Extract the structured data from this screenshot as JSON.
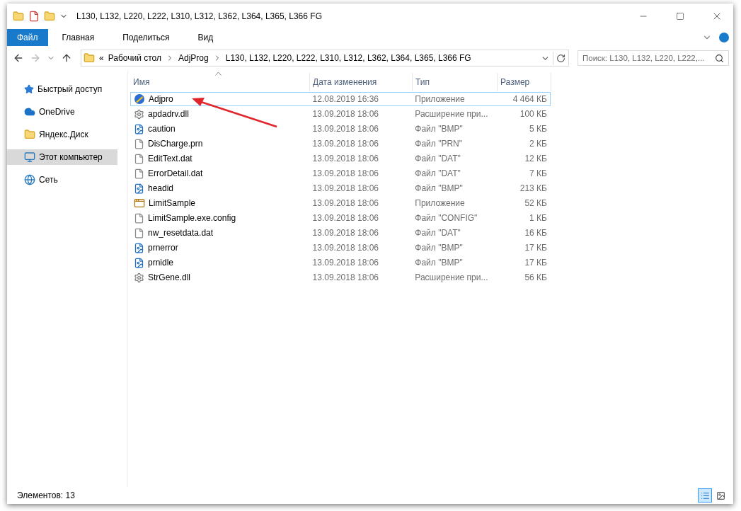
{
  "window": {
    "title": "L130, L132, L220, L222, L310, L312, L362, L364, L365, L366 FG"
  },
  "ribbon": {
    "tabs": [
      {
        "label": "Файл",
        "selected": true
      },
      {
        "label": "Главная",
        "selected": false
      },
      {
        "label": "Поделиться",
        "selected": false
      },
      {
        "label": "Вид",
        "selected": false
      }
    ]
  },
  "address": {
    "overflow": "«",
    "crumbs": [
      "Рабочий стол",
      "AdjProg",
      "L130, L132, L220, L222, L310, L312, L362, L364, L365, L366 FG"
    ]
  },
  "search": {
    "placeholder": "Поиск: L130, L132, L220, L222,..."
  },
  "sidebar": {
    "items": [
      {
        "label": "Быстрый доступ",
        "kind": "star",
        "selected": false
      },
      {
        "label": "OneDrive",
        "kind": "cloud",
        "selected": false
      },
      {
        "label": "Яндекс.Диск",
        "kind": "folder",
        "selected": false
      },
      {
        "label": "Этот компьютер",
        "kind": "computer",
        "selected": true
      },
      {
        "label": "Сеть",
        "kind": "network",
        "selected": false
      }
    ]
  },
  "table": {
    "columns": [
      {
        "label": "Имя",
        "sorted": true
      },
      {
        "label": "Дата изменения",
        "sorted": false
      },
      {
        "label": "Тип",
        "sorted": false
      },
      {
        "label": "Размер",
        "sorted": false
      }
    ],
    "rows": [
      {
        "name": "Adjpro",
        "date": "12.08.2019 16:36",
        "type": "Приложение",
        "size": "4 464 КБ",
        "kind": "app",
        "selected": true
      },
      {
        "name": "apdadrv.dll",
        "date": "13.09.2018 18:06",
        "type": "Расширение при...",
        "size": "100 КБ",
        "kind": "dll",
        "selected": false
      },
      {
        "name": "caution",
        "date": "13.09.2018 18:06",
        "type": "Файл \"BMP\"",
        "size": "5 КБ",
        "kind": "image",
        "selected": false
      },
      {
        "name": "DisCharge.prn",
        "date": "13.09.2018 18:06",
        "type": "Файл \"PRN\"",
        "size": "2 КБ",
        "kind": "file",
        "selected": false
      },
      {
        "name": "EditText.dat",
        "date": "13.09.2018 18:06",
        "type": "Файл \"DAT\"",
        "size": "12 КБ",
        "kind": "file",
        "selected": false
      },
      {
        "name": "ErrorDetail.dat",
        "date": "13.09.2018 18:06",
        "type": "Файл \"DAT\"",
        "size": "7 КБ",
        "kind": "file",
        "selected": false
      },
      {
        "name": "headid",
        "date": "13.09.2018 18:06",
        "type": "Файл \"BMP\"",
        "size": "213 КБ",
        "kind": "image",
        "selected": false
      },
      {
        "name": "LimitSample",
        "date": "13.09.2018 18:06",
        "type": "Приложение",
        "size": "52 КБ",
        "kind": "window",
        "selected": false
      },
      {
        "name": "LimitSample.exe.config",
        "date": "13.09.2018 18:06",
        "type": "Файл \"CONFIG\"",
        "size": "1 КБ",
        "kind": "file",
        "selected": false
      },
      {
        "name": "nw_resetdata.dat",
        "date": "13.09.2018 18:06",
        "type": "Файл \"DAT\"",
        "size": "16 КБ",
        "kind": "file",
        "selected": false
      },
      {
        "name": "prnerror",
        "date": "13.09.2018 18:06",
        "type": "Файл \"BMP\"",
        "size": "17 КБ",
        "kind": "image",
        "selected": false
      },
      {
        "name": "prnidle",
        "date": "13.09.2018 18:06",
        "type": "Файл \"BMP\"",
        "size": "17 КБ",
        "kind": "image",
        "selected": false
      },
      {
        "name": "StrGene.dll",
        "date": "13.09.2018 18:06",
        "type": "Расширение при...",
        "size": "56 КБ",
        "kind": "dll",
        "selected": false
      }
    ]
  },
  "status_bar": {
    "count": "Элементов: 13",
    "views": [
      {
        "kind": "details",
        "selected": true
      },
      {
        "kind": "preview",
        "selected": false
      }
    ]
  }
}
